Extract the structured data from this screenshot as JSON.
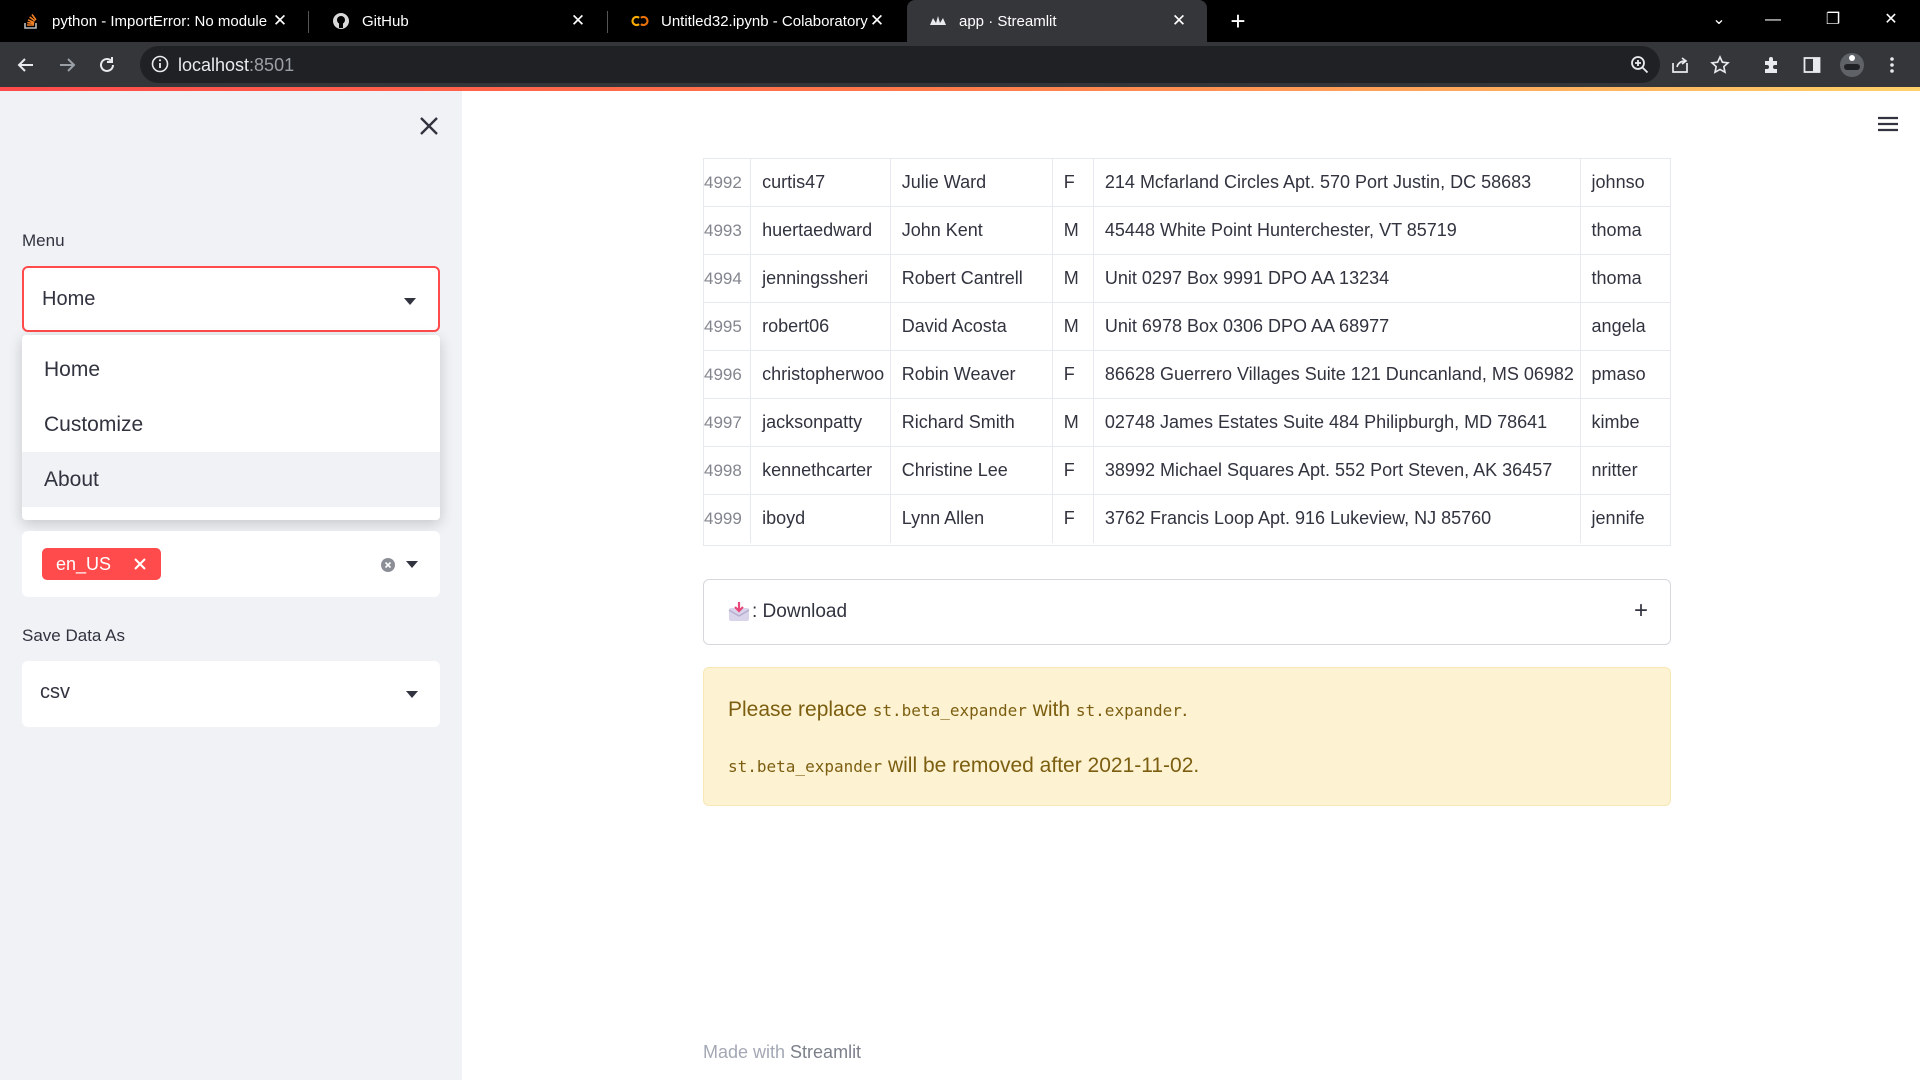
{
  "browser": {
    "tabs": [
      {
        "title": "python - ImportError: No module",
        "icon": "stackoverflow-icon"
      },
      {
        "title": "GitHub",
        "icon": "github-icon"
      },
      {
        "title": "Untitled32.ipynb - Colaboratory",
        "icon": "colab-icon"
      },
      {
        "title": "app · Streamlit",
        "icon": "streamlit-icon"
      }
    ],
    "url_host": "localhost",
    "url_port": ":8501"
  },
  "sidebar": {
    "menu_label": "Menu",
    "menu_selected": "Home",
    "menu_options": [
      "Home",
      "Customize",
      "About"
    ],
    "locale_chip": "en_US",
    "save_label": "Save Data As",
    "save_selected": "csv"
  },
  "table": {
    "rows": [
      {
        "index": "4992",
        "username": "curtis47",
        "name": "Julie Ward",
        "sex": "F",
        "address": "214 Mcfarland Circles Apt. 570 Port Justin, DC 58683",
        "email": "johnso"
      },
      {
        "index": "4993",
        "username": "huertaedward",
        "name": "John Kent",
        "sex": "M",
        "address": "45448 White Point Hunterchester, VT 85719",
        "email": "thoma"
      },
      {
        "index": "4994",
        "username": "jenningssheri",
        "name": "Robert Cantrell",
        "sex": "M",
        "address": "Unit 0297 Box 9991 DPO AA 13234",
        "email": "thoma"
      },
      {
        "index": "4995",
        "username": "robert06",
        "name": "David Acosta",
        "sex": "M",
        "address": "Unit 6978 Box 0306 DPO AA 68977",
        "email": "angela"
      },
      {
        "index": "4996",
        "username": "christopherwoo",
        "name": "Robin Weaver",
        "sex": "F",
        "address": "86628 Guerrero Villages Suite 121 Duncanland, MS 06982",
        "email": "pmaso"
      },
      {
        "index": "4997",
        "username": "jacksonpatty",
        "name": "Richard Smith",
        "sex": "M",
        "address": "02748 James Estates Suite 484 Philipburgh, MD 78641",
        "email": "kimbe"
      },
      {
        "index": "4998",
        "username": "kennethcarter",
        "name": "Christine Lee",
        "sex": "F",
        "address": "38992 Michael Squares Apt. 552 Port Steven, AK 36457",
        "email": "nritter"
      },
      {
        "index": "4999",
        "username": "iboyd",
        "name": "Lynn Allen",
        "sex": "F",
        "address": "3762 Francis Loop Apt. 916 Lukeview, NJ 85760",
        "email": "jennife"
      }
    ]
  },
  "expander": {
    "label": ": Download",
    "plus": "+"
  },
  "warning": {
    "w1": "Please replace ",
    "code1": "st.beta_expander",
    "w2": " with ",
    "code2": "st.expander",
    "w3": ".",
    "code3": "st.beta_expander",
    "w4": " will be removed after 2021-11-02."
  },
  "footer": {
    "prefix": "Made with ",
    "brand": "Streamlit"
  }
}
